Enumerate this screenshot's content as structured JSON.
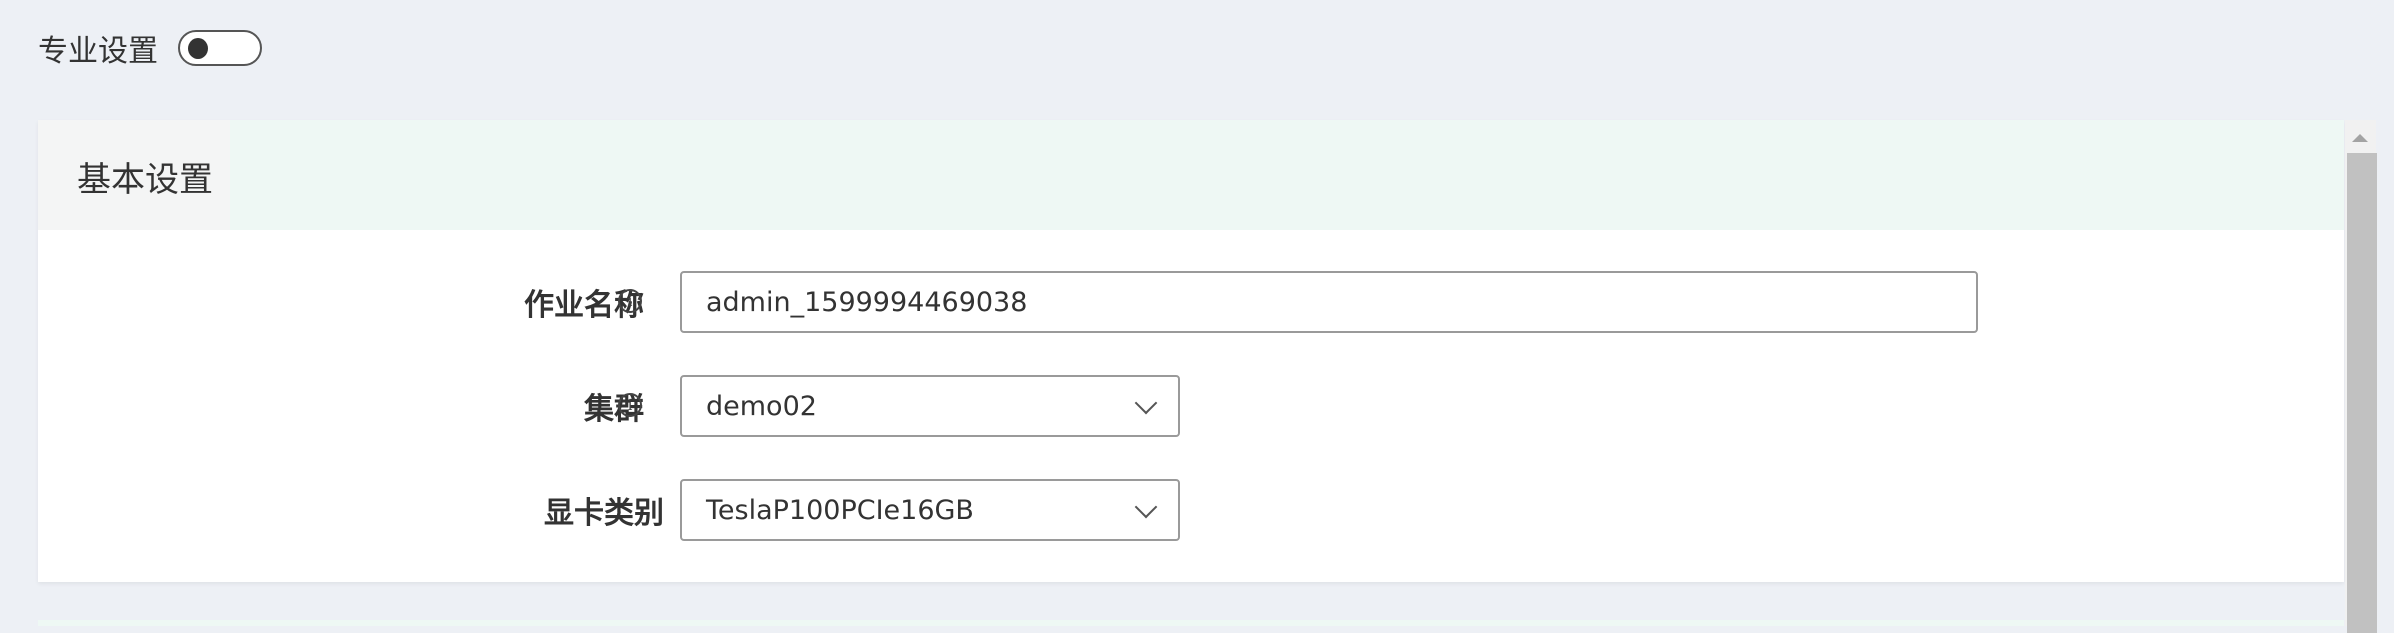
{
  "pro_settings": {
    "label": "专业设置",
    "enabled": false
  },
  "basic_section": {
    "tab_label": "基本设置",
    "fields": [
      {
        "label": "作业名称",
        "value": "admin_1599994469038",
        "type": "text",
        "info_icon": "i"
      },
      {
        "label": "集群",
        "value": "demo02",
        "type": "select",
        "info_icon": "i"
      },
      {
        "label": "显卡类别",
        "value": "TeslaP100PCIe16GB",
        "type": "select"
      }
    ]
  }
}
